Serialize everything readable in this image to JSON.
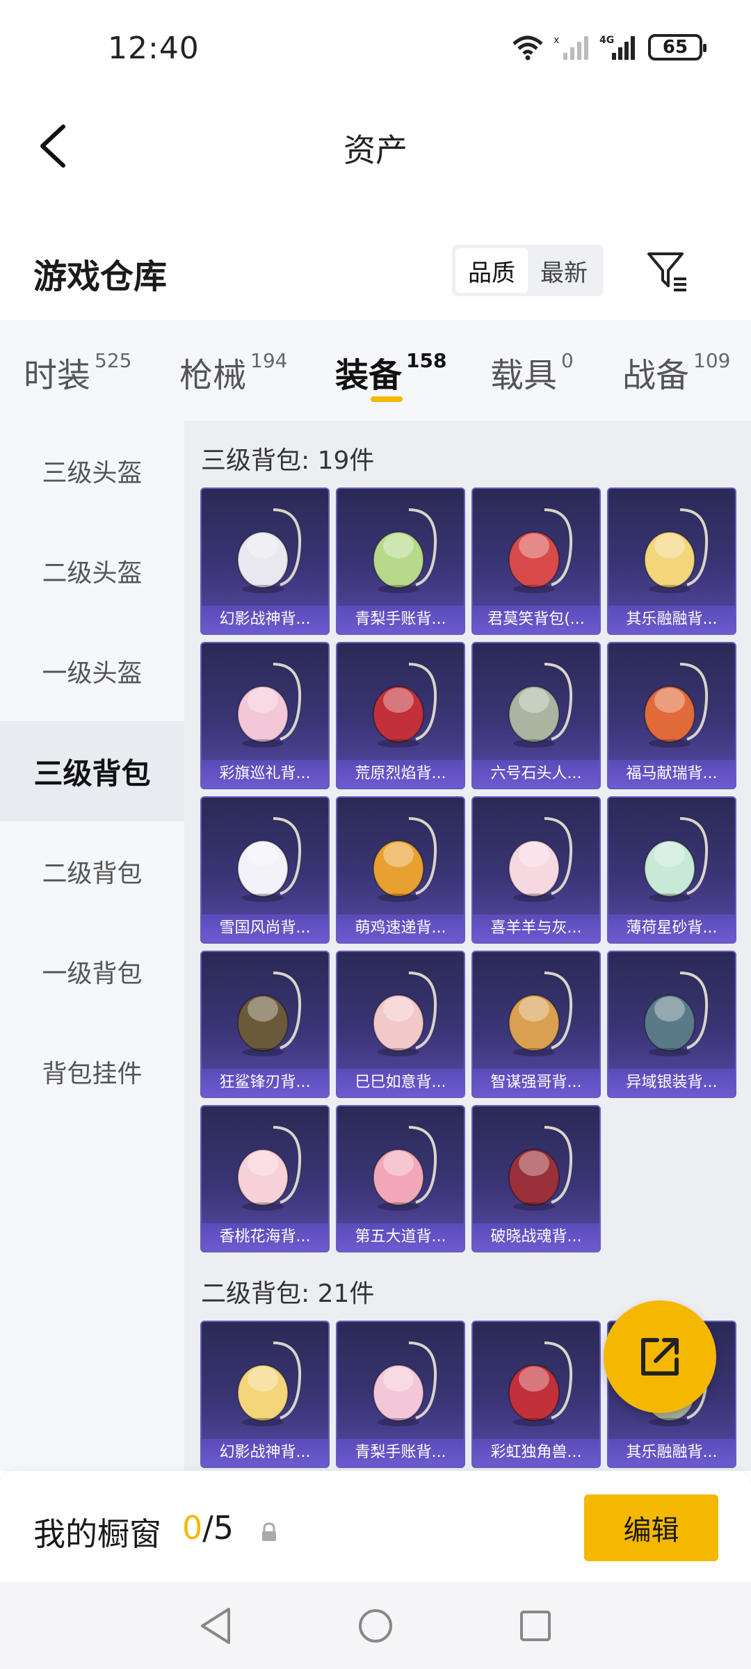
{
  "status": {
    "time": "12:40",
    "battery": "65",
    "network": "4G"
  },
  "header": {
    "title": "资产"
  },
  "warehouse": {
    "title": "游戏仓库",
    "sort_options": [
      "品质",
      "最新"
    ]
  },
  "tabs": [
    {
      "label": "时装",
      "count": "525"
    },
    {
      "label": "枪械",
      "count": "194"
    },
    {
      "label": "装备",
      "count": "158"
    },
    {
      "label": "载具",
      "count": "0"
    },
    {
      "label": "战备",
      "count": "109"
    }
  ],
  "sidebar": {
    "items": [
      {
        "label": "三级头盔"
      },
      {
        "label": "二级头盔"
      },
      {
        "label": "一级头盔"
      },
      {
        "label": "三级背包"
      },
      {
        "label": "二级背包"
      },
      {
        "label": "一级背包"
      },
      {
        "label": "背包挂件"
      }
    ]
  },
  "sections": [
    {
      "title": "三级背包: 19件",
      "items": [
        {
          "name": "幻影战神背...",
          "icon": "backpack-icon"
        },
        {
          "name": "青梨手账背...",
          "icon": "backpack-icon"
        },
        {
          "name": "君莫笑背包(...",
          "icon": "backpack-icon"
        },
        {
          "name": "其乐融融背...",
          "icon": "backpack-icon"
        },
        {
          "name": "彩旗巡礼背...",
          "icon": "backpack-icon"
        },
        {
          "name": "荒原烈焰背...",
          "icon": "backpack-icon"
        },
        {
          "name": "六号石头人...",
          "icon": "backpack-icon"
        },
        {
          "name": "福马献瑞背...",
          "icon": "backpack-icon"
        },
        {
          "name": "雪国风尚背...",
          "icon": "backpack-icon"
        },
        {
          "name": "萌鸡速递背...",
          "icon": "backpack-icon"
        },
        {
          "name": "喜羊羊与灰...",
          "icon": "backpack-icon"
        },
        {
          "name": "薄荷星砂背...",
          "icon": "backpack-icon"
        },
        {
          "name": "狂鲨锋刃背...",
          "icon": "backpack-icon"
        },
        {
          "name": "巳巳如意背...",
          "icon": "backpack-icon"
        },
        {
          "name": "智谋强哥背...",
          "icon": "backpack-icon"
        },
        {
          "name": "异域银装背...",
          "icon": "backpack-icon"
        },
        {
          "name": "香桃花海背...",
          "icon": "backpack-icon"
        },
        {
          "name": "第五大道背...",
          "icon": "backpack-icon"
        },
        {
          "name": "破晓战魂背...",
          "icon": "backpack-icon"
        }
      ]
    },
    {
      "title": "二级背包: 21件",
      "items": [
        {
          "name": "幻影战神背...",
          "icon": "backpack-icon"
        },
        {
          "name": "青梨手账背...",
          "icon": "backpack-icon"
        },
        {
          "name": "彩虹独角兽...",
          "icon": "backpack-icon"
        },
        {
          "name": "其乐融融背...",
          "icon": "backpack-icon"
        }
      ]
    }
  ],
  "showcase": {
    "label": "我的橱窗",
    "used": "0",
    "total": "/5",
    "edit_label": "编辑"
  },
  "colors": {
    "accent": "#f5b800",
    "card_bg": "#3a3576",
    "card_label": "#6d5bd0"
  }
}
